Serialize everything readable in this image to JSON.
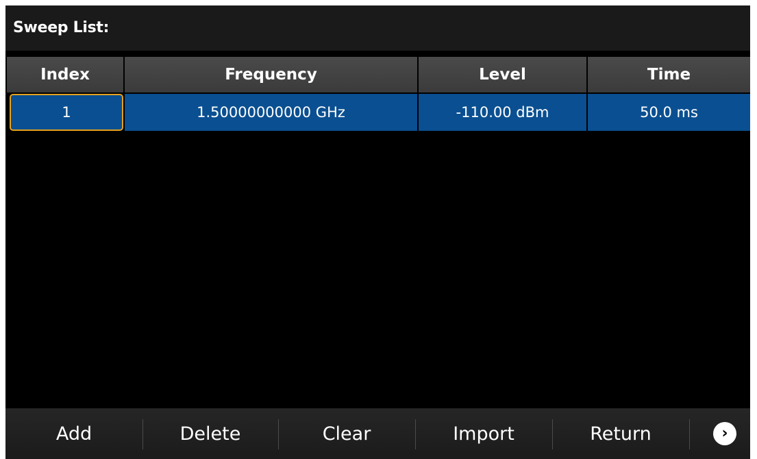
{
  "title": "Sweep List:",
  "table": {
    "columns": [
      "Index",
      "Frequency",
      "Level",
      "Time"
    ],
    "rows": [
      {
        "index": "1",
        "frequency": "1.50000000000 GHz",
        "level": "-110.00 dBm",
        "time": "50.0 ms",
        "selected_cell": "index"
      }
    ]
  },
  "softkeys": [
    "Add",
    "Delete",
    "Clear",
    "Import",
    "Return"
  ],
  "next_icon": "chevron-right-circle-icon",
  "colors": {
    "row_selected": "#0a4f91",
    "focus_border": "#e5a21c",
    "header_bg": "#444444"
  }
}
